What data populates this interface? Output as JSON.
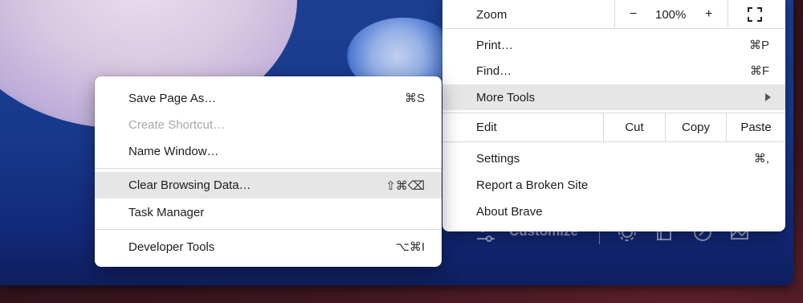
{
  "main_menu": {
    "zoom": {
      "label": "Zoom",
      "minus": "−",
      "level": "100%",
      "plus": "+"
    },
    "print": {
      "label": "Print…",
      "shortcut": "⌘P"
    },
    "find": {
      "label": "Find…",
      "shortcut": "⌘F"
    },
    "more_tools": {
      "label": "More Tools"
    },
    "edit": {
      "label": "Edit",
      "cut": "Cut",
      "copy": "Copy",
      "paste": "Paste"
    },
    "settings": {
      "label": "Settings",
      "shortcut": "⌘,"
    },
    "report": {
      "label": "Report a Broken Site"
    },
    "about": {
      "label": "About Brave"
    }
  },
  "sub_menu": {
    "save_page": {
      "label": "Save Page As…",
      "shortcut": "⌘S"
    },
    "create_shortcut": {
      "label": "Create Shortcut…"
    },
    "name_window": {
      "label": "Name Window…"
    },
    "clear_data": {
      "label": "Clear Browsing Data…",
      "shortcut": "⇧⌘⌫"
    },
    "task_manager": {
      "label": "Task Manager"
    },
    "dev_tools": {
      "label": "Developer Tools",
      "shortcut": "⌥⌘I"
    }
  },
  "background": {
    "customize_label": "Customize"
  },
  "colors": {
    "highlight": "#e6e6e6",
    "disabled_text": "#a8a8a8",
    "window_blue": "#183a8c"
  }
}
